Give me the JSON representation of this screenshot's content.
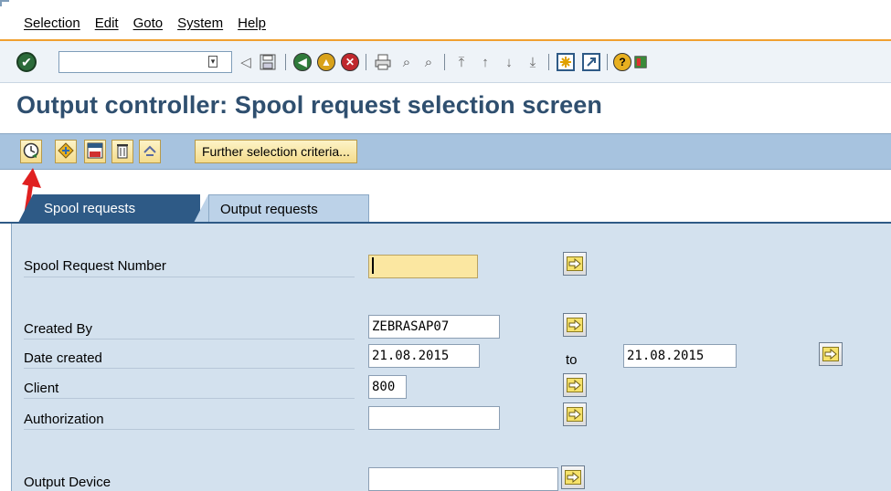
{
  "menu": [
    "Selection",
    "Edit",
    "Goto",
    "System",
    "Help"
  ],
  "command_field": {
    "value": ""
  },
  "title": "Output controller: Spool request selection screen",
  "app_toolbar": {
    "further_label": "Further selection criteria..."
  },
  "tabs": [
    {
      "label": "Spool requests",
      "active": true
    },
    {
      "label": "Output requests",
      "active": false
    }
  ],
  "form": {
    "spool_request_number": {
      "label": "Spool Request Number",
      "value": ""
    },
    "created_by": {
      "label": "Created By",
      "value": "ZEBRASAP07"
    },
    "date_created": {
      "label": "Date created",
      "from": "21.08.2015",
      "to_label": "to",
      "to": "21.08.2015"
    },
    "client": {
      "label": "Client",
      "value": "800"
    },
    "authorization": {
      "label": "Authorization",
      "value": ""
    },
    "output_device": {
      "label": "Output Device",
      "value": ""
    }
  },
  "colors": {
    "title": "#2f4f6f",
    "app_toolbar": "#a7c3df",
    "active_tab": "#2e5a86",
    "panel": "#d3e1ee",
    "required_field": "#fbe7a1",
    "menu_separator": "#f0a030",
    "annotation_arrow": "#e02020"
  }
}
